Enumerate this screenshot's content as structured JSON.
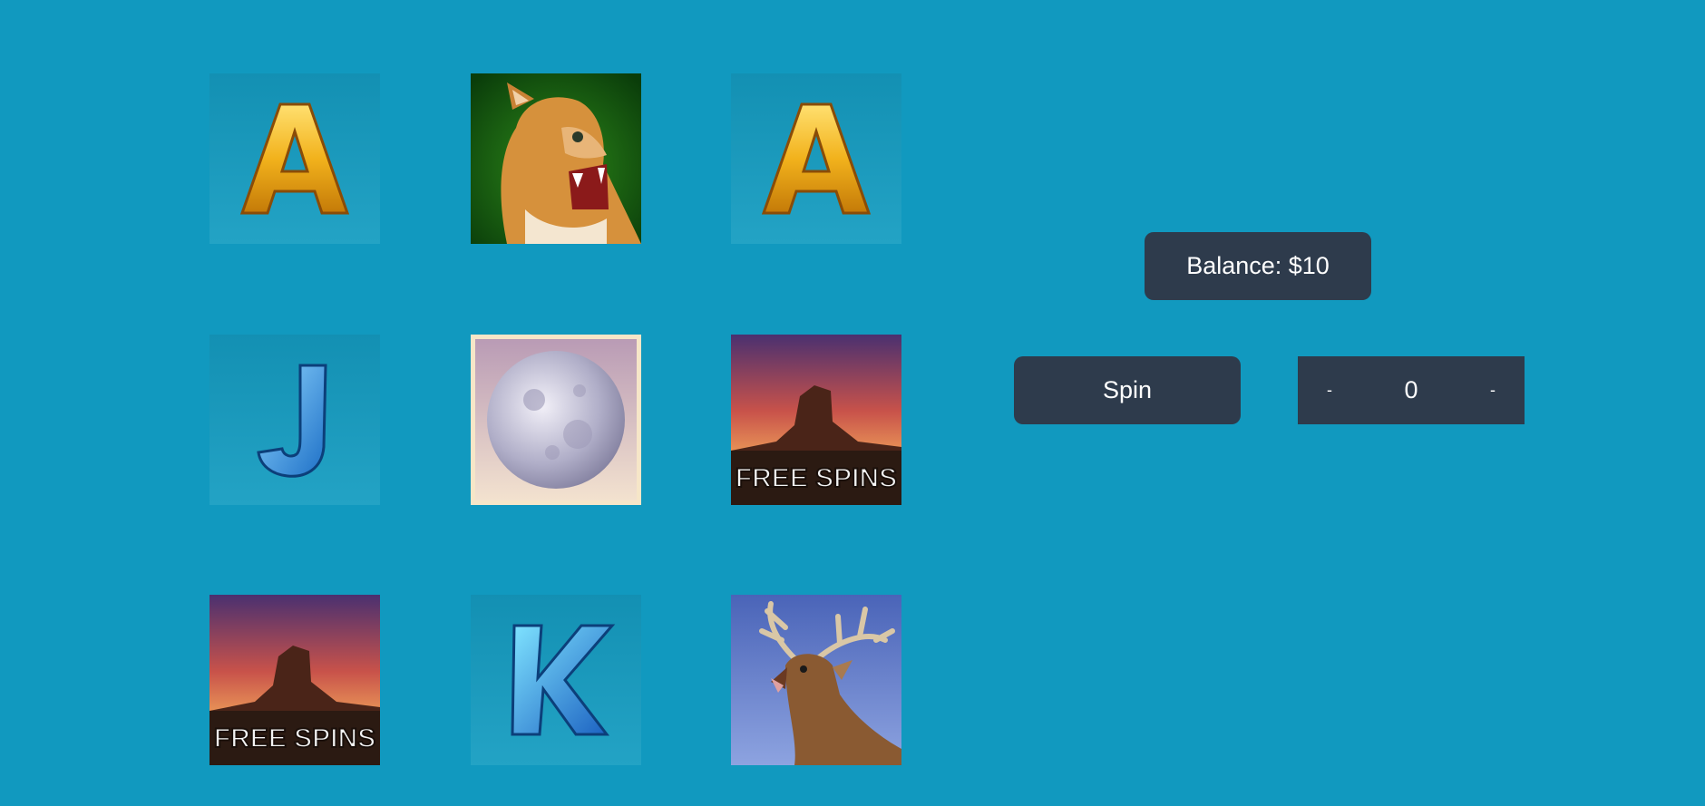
{
  "reels": [
    [
      "letter-a",
      "cougar",
      "letter-a"
    ],
    [
      "letter-j",
      "moon",
      "free-spins"
    ],
    [
      "free-spins",
      "letter-k",
      "elk"
    ]
  ],
  "free_spins_label": "FREE SPINS",
  "balance": {
    "text": "Balance: $10"
  },
  "spin": {
    "label": "Spin"
  },
  "bet": {
    "decrement": "-",
    "value": "0",
    "increment": "-"
  },
  "colors": {
    "background": "#1199bf",
    "panel": "#2e3b4c",
    "text": "#ffffff"
  }
}
